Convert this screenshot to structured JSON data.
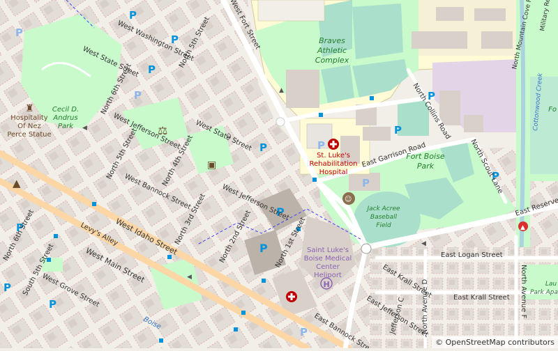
{
  "map": {
    "attribution": "© OpenStreetMap contributors",
    "colors": {
      "background": "#f2efe9",
      "block": "#e0dbd4",
      "building": "#d9d0c9",
      "park": "#c8facc",
      "pitch": "#aae0cb",
      "water": "#aad3df",
      "hospital_area": "#ffffe5",
      "school_area": "#e3d4e8",
      "road": "#ffffff",
      "poi_blue": "#0092da",
      "hospital_red": "#bf0000",
      "park_label": "#237d2c"
    },
    "labels": {
      "streets": {
        "west_washington": "West Washington Street",
        "west_state_1": "West State Street",
        "west_state_2": "West State Street",
        "west_jefferson_1": "West Jefferson Street",
        "west_jefferson_2": "West Jefferson Street",
        "west_bannock": "West Bannock Street",
        "west_idaho": "West Idaho Street",
        "west_main": "West Main Street",
        "west_grove": "West Grove Street",
        "levys_alley": "Levy's Alley",
        "north_5th_top": "North 5th Street",
        "north_5th_mid": "North 5th Street",
        "north_6th_top": "North 6th Street",
        "north_6th_bottom": "North 6th Street",
        "north_4th": "North 4th Street",
        "north_3rd": "North 3rd Street",
        "north_2nd": "North 2nd Street",
        "north_1st": "North 1st Street",
        "south_5th": "South 5th Street",
        "west_fort": "West Fort Street",
        "north_collins": "North Collins Road",
        "east_garrison": "East Garrison Road",
        "north_scout": "North Scout Lane",
        "east_reserve": "East Reserve Street",
        "north_mountain_cove": "North Mountain Cove Road",
        "east_logan": "East Logan Street",
        "east_krall_1": "East Krall Street",
        "east_krall_2": "East Krall Street",
        "east_jefferson": "East Jefferson Street",
        "east_bannock": "East Bannock Street",
        "jefferson_c": "Jefferson C",
        "north_avenue_d": "North Avenue D",
        "north_avenue_f": "North Avenue F",
        "cottonwood_creek": "Cottonwood Creek",
        "military_reserve": "Military Res",
        "boise": "Boise"
      },
      "places": {
        "braves": [
          "Braves",
          "Athletic",
          "Complex"
        ],
        "fort_boise": [
          "Fort Boise",
          "Park"
        ],
        "cecil": [
          "Cecil D.",
          "Andrus",
          "Park"
        ],
        "jack_acree": [
          "Jack Acree",
          "Baseball",
          "Field"
        ],
        "st_lukes_rehab": [
          "St. Luke's",
          "Rehabilitation",
          "Hospital"
        ],
        "st_lukes_boise": [
          "Saint Luke's",
          "Boise Medical",
          "Center",
          "Heliport"
        ],
        "hospitality": [
          "Hospitality",
          "Of Nez",
          "Perce Statue"
        ],
        "lau": [
          "Lau",
          "Park Apa"
        ],
        "fo": [
          "Fo"
        ]
      },
      "icons": {
        "parking": "P",
        "heliport": "H"
      }
    }
  }
}
